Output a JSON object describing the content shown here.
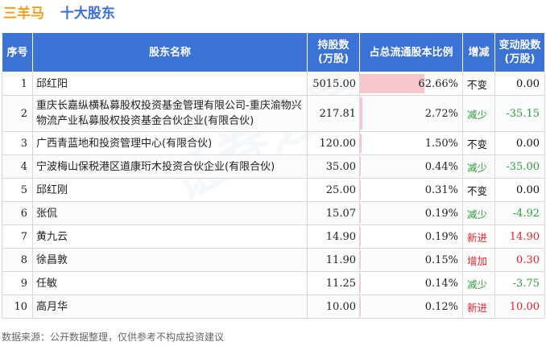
{
  "header": {
    "company": "三羊马",
    "title": "十大股东"
  },
  "table": {
    "columns": [
      "序号",
      "股东名称",
      "持股数\n(万股)",
      "占总流通股本比例",
      "增减",
      "变动股数\n(万股)"
    ],
    "rows": [
      {
        "idx": "1",
        "name": "邱红阳",
        "shares": "5015.00",
        "ratio": "62.66%",
        "ratio_value": 62.66,
        "chg": "不变",
        "chg_type": "same",
        "change": "0.00"
      },
      {
        "idx": "2",
        "name": "重庆长嘉纵横私募股权投资基金管理有限公司-重庆渝物兴物流产业私募股权投资基金合伙企业(有限合伙)",
        "shares": "217.81",
        "ratio": "2.72%",
        "ratio_value": 2.72,
        "chg": "减少",
        "chg_type": "dec",
        "change": "-35.15"
      },
      {
        "idx": "3",
        "name": "广西青蓝地和投资管理中心(有限合伙)",
        "shares": "120.00",
        "ratio": "1.50%",
        "ratio_value": 1.5,
        "chg": "不变",
        "chg_type": "same",
        "change": "0.00"
      },
      {
        "idx": "4",
        "name": "宁波梅山保税港区道康珩木投资合伙企业(有限合伙)",
        "shares": "35.00",
        "ratio": "0.44%",
        "ratio_value": 0.44,
        "chg": "减少",
        "chg_type": "dec",
        "change": "-35.00"
      },
      {
        "idx": "5",
        "name": "邱红刚",
        "shares": "25.00",
        "ratio": "0.31%",
        "ratio_value": 0.31,
        "chg": "不变",
        "chg_type": "same",
        "change": "0.00"
      },
      {
        "idx": "6",
        "name": "张侃",
        "shares": "15.07",
        "ratio": "0.19%",
        "ratio_value": 0.19,
        "chg": "减少",
        "chg_type": "dec",
        "change": "-4.92"
      },
      {
        "idx": "7",
        "name": "黄九云",
        "shares": "14.90",
        "ratio": "0.19%",
        "ratio_value": 0.19,
        "chg": "新进",
        "chg_type": "inc",
        "change": "14.90"
      },
      {
        "idx": "8",
        "name": "徐昌敦",
        "shares": "11.90",
        "ratio": "0.15%",
        "ratio_value": 0.15,
        "chg": "增加",
        "chg_type": "inc",
        "change": "0.30"
      },
      {
        "idx": "9",
        "name": "任敏",
        "shares": "11.25",
        "ratio": "0.14%",
        "ratio_value": 0.14,
        "chg": "减少",
        "chg_type": "dec",
        "change": "-3.75"
      },
      {
        "idx": "10",
        "name": "高月华",
        "shares": "10.00",
        "ratio": "0.12%",
        "ratio_value": 0.12,
        "chg": "新进",
        "chg_type": "inc",
        "change": "10.00"
      }
    ]
  },
  "colors": {
    "header_bg": "#3b72d6",
    "bar": "#f7c6cc",
    "decrease": "#2e9b3a",
    "increase": "#e0242a",
    "company": "#f0a020",
    "title": "#3a6fd8"
  },
  "footer": "数据来源：公开数据整理，仅供参考不构成投资建议",
  "watermark": "证券之星"
}
